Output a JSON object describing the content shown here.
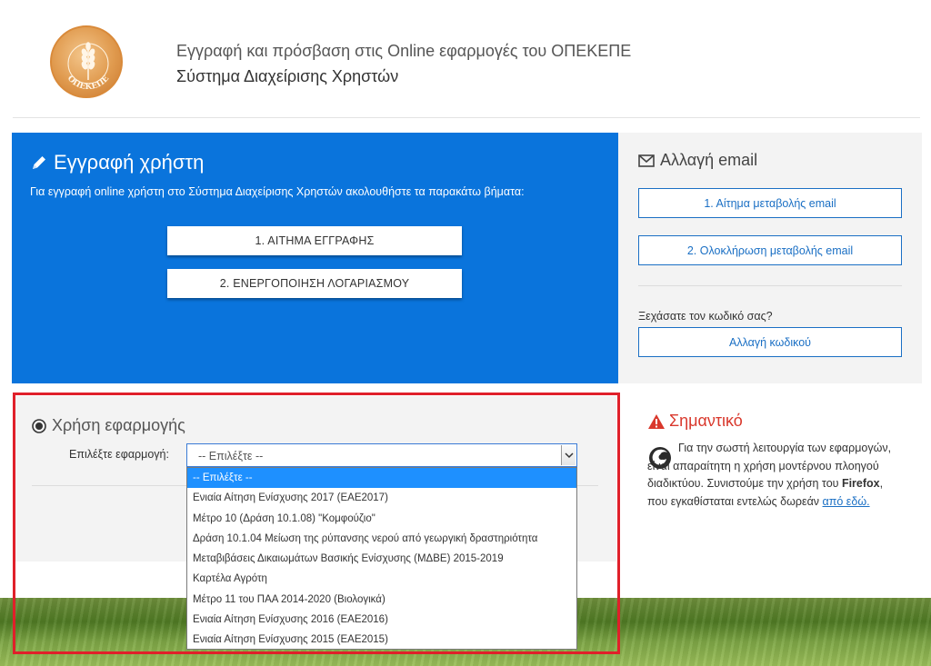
{
  "header": {
    "line1": "Εγγραφή και πρόσβαση στις Online εφαρμογές του ΟΠΕΚΕΠΕ",
    "line2": "Σύστημα Διαχείρισης Χρηστών",
    "logo_text": "ΟΠΕΚΕΠΕ"
  },
  "registration": {
    "title": "Εγγραφή χρήστη",
    "description": "Για εγγραφή online χρήστη στο Σύστημα Διαχείρισης Χρηστών ακολουθήστε τα παρακάτω βήματα:",
    "step1": "1. ΑΙΤΗΜΑ ΕΓΓΡΑΦΗΣ",
    "step2": "2. ΕΝΕΡΓΟΠΟΙΗΣΗ ΛΟΓΑΡΙΑΣΜΟΥ"
  },
  "email_change": {
    "title": "Αλλαγή email",
    "btn1": "1. Αίτημα μεταβολής email",
    "btn2": "2. Ολοκλήρωση μεταβολής email",
    "forgot": "Ξεχάσατε τον κωδικό σας?",
    "btn3": "Αλλαγή κωδικού"
  },
  "app_usage": {
    "title": "Χρήση εφαρμογής",
    "select_label": "Επιλέξτε εφαρμογή:",
    "selected_value": "-- Επιλέξτε --",
    "options": [
      "-- Επιλέξτε --",
      "Ενιαία Αίτηση Ενίσχυσης 2017 (ΕΑΕ2017)",
      "Μέτρο 10 (Δράση 10.1.08) \"Κομφούζιο\"",
      "Δράση 10.1.04 Μείωση της ρύπανσης νερού από γεωργική δραστηριότητα",
      "Μεταβιβάσεις Δικαιωμάτων Βασικής Ενίσχυσης (ΜΔΒΕ) 2015-2019",
      "Καρτέλα Αγρότη",
      "Μέτρο 11 του ΠΑΑ 2014-2020 (Βιολογικά)",
      "Ενιαία Αίτηση Ενίσχυσης 2016 (ΕΑΕ2016)",
      "Ενιαία Αίτηση Ενίσχυσης 2015 (ΕΑΕ2015)"
    ]
  },
  "important": {
    "title": "Σημαντικό",
    "text_before": "Για την σωστή λειτουργία των εφαρμογών, είναι απαραίτητη η χρήση μοντέρνου πλοηγού διαδικτύου. Συνιστούμε την χρήση του ",
    "browser": "Firefox",
    "text_after": ", που εγκαθίσταται εντελώς δωρεάν ",
    "link": "από εδώ."
  },
  "colors": {
    "blue_panel": "#0a74dc",
    "link": "#1a6fc4",
    "important": "#d9382c",
    "highlight_frame": "#e0202a",
    "option_selected": "#1e90ff"
  }
}
